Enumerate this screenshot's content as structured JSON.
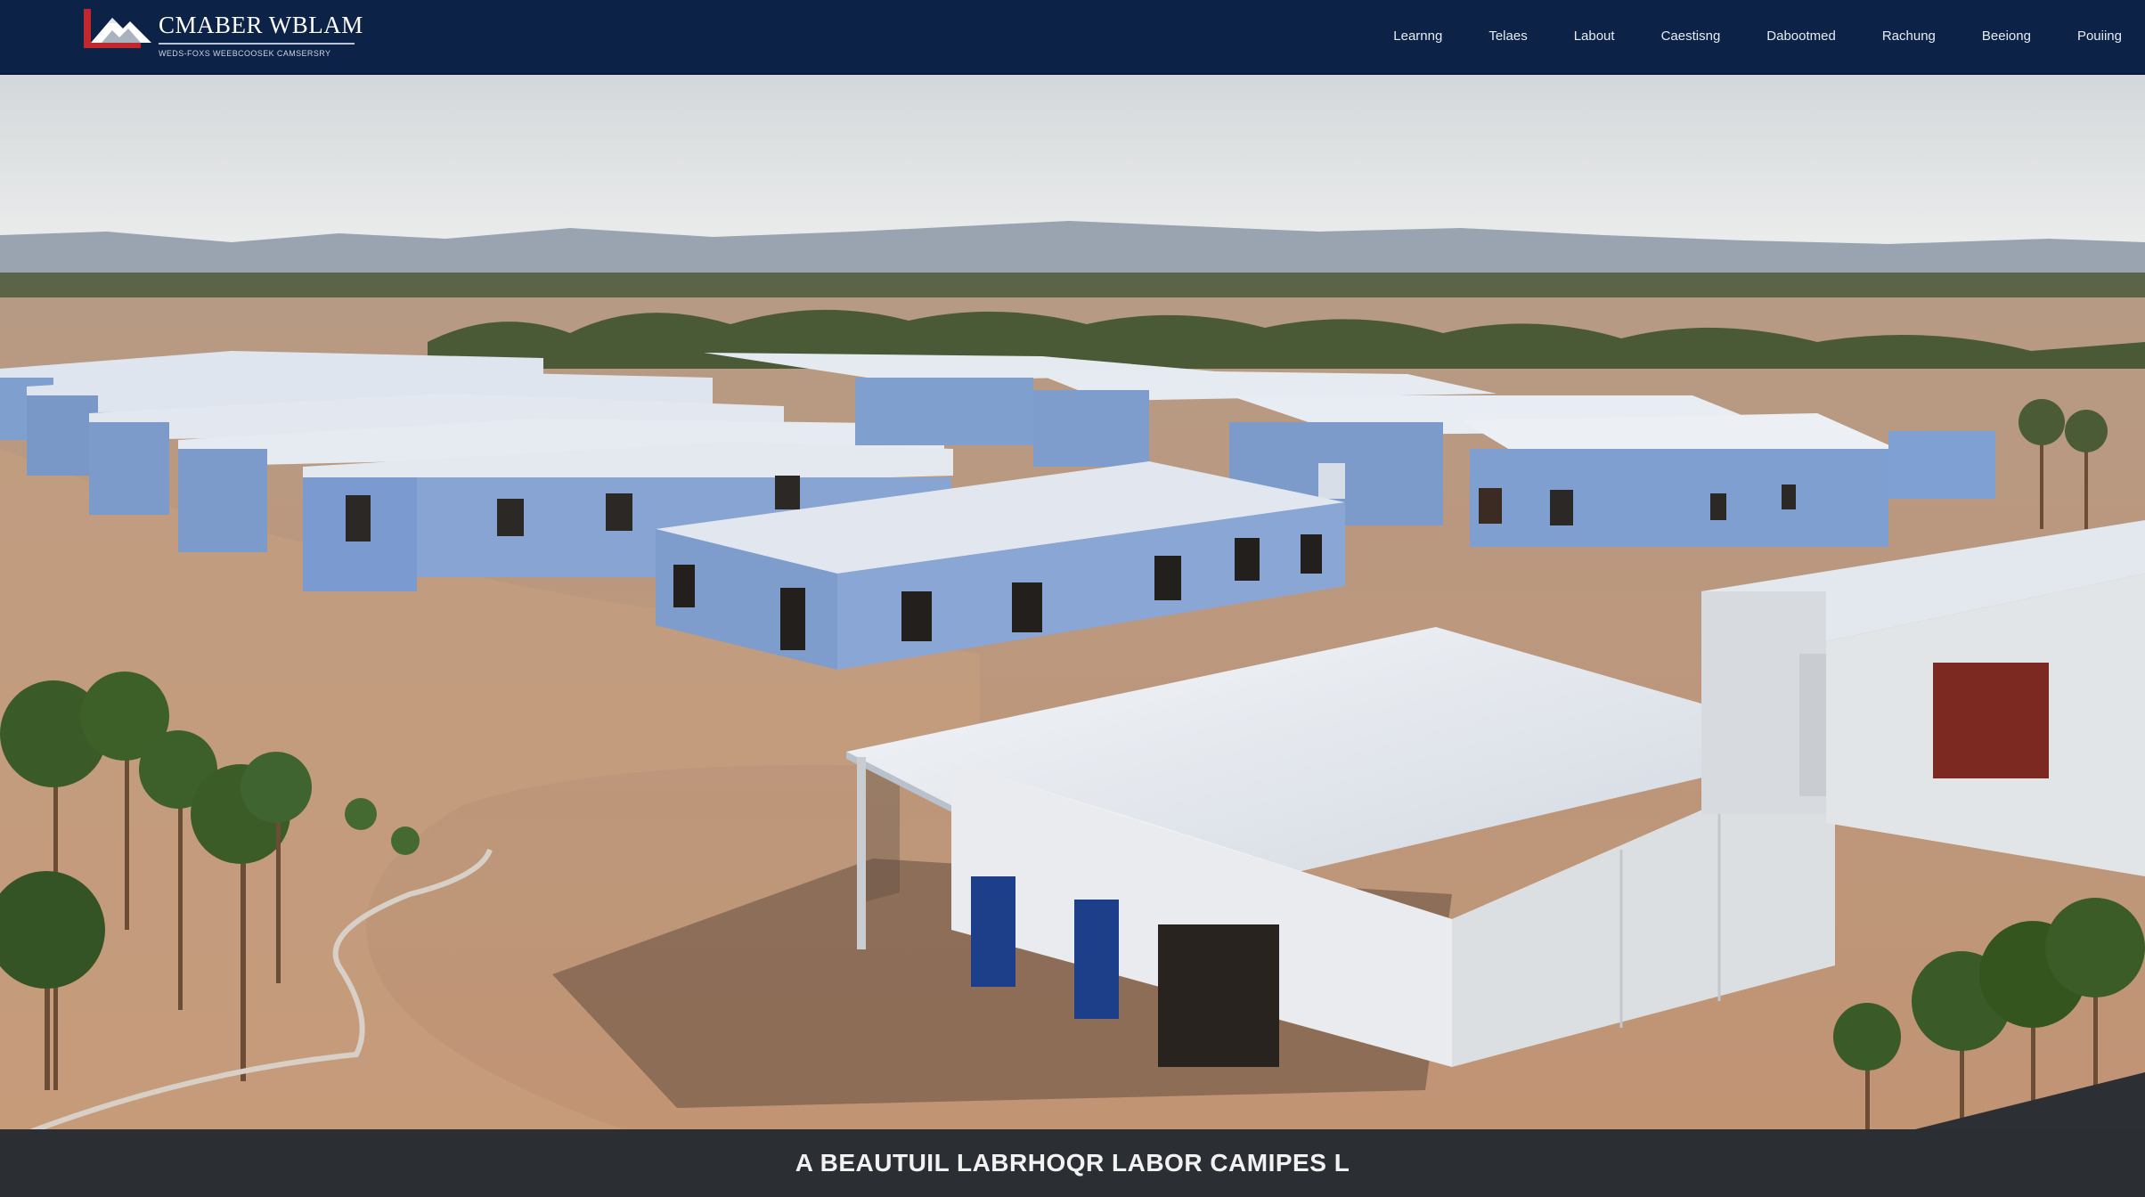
{
  "header": {
    "logo_title": "CMABER WBLAM",
    "logo_subtitle": "WEDS-FOXS WEEBCOOSEK CAMSERSRY",
    "nav_items": [
      {
        "label": "Learnng"
      },
      {
        "label": "Telaes"
      },
      {
        "label": "Labout"
      },
      {
        "label": "Caestisng"
      },
      {
        "label": "Dabootmed"
      },
      {
        "label": "Rachung"
      },
      {
        "label": "Beeiong"
      },
      {
        "label": "Pouiing"
      }
    ]
  },
  "hero": {
    "caption": "A BEAUTUIL LABRHOQR LABOR CAMIPES L"
  },
  "colors": {
    "navbar": "#0d2247",
    "caption_bar": "#2b2f34",
    "ground": "#b98d6b",
    "building_blue": "#7f9fcf",
    "roof": "#dfe5ee",
    "logo_red": "#c0282d"
  },
  "icons": {
    "logo": "mountain-logo-icon"
  }
}
